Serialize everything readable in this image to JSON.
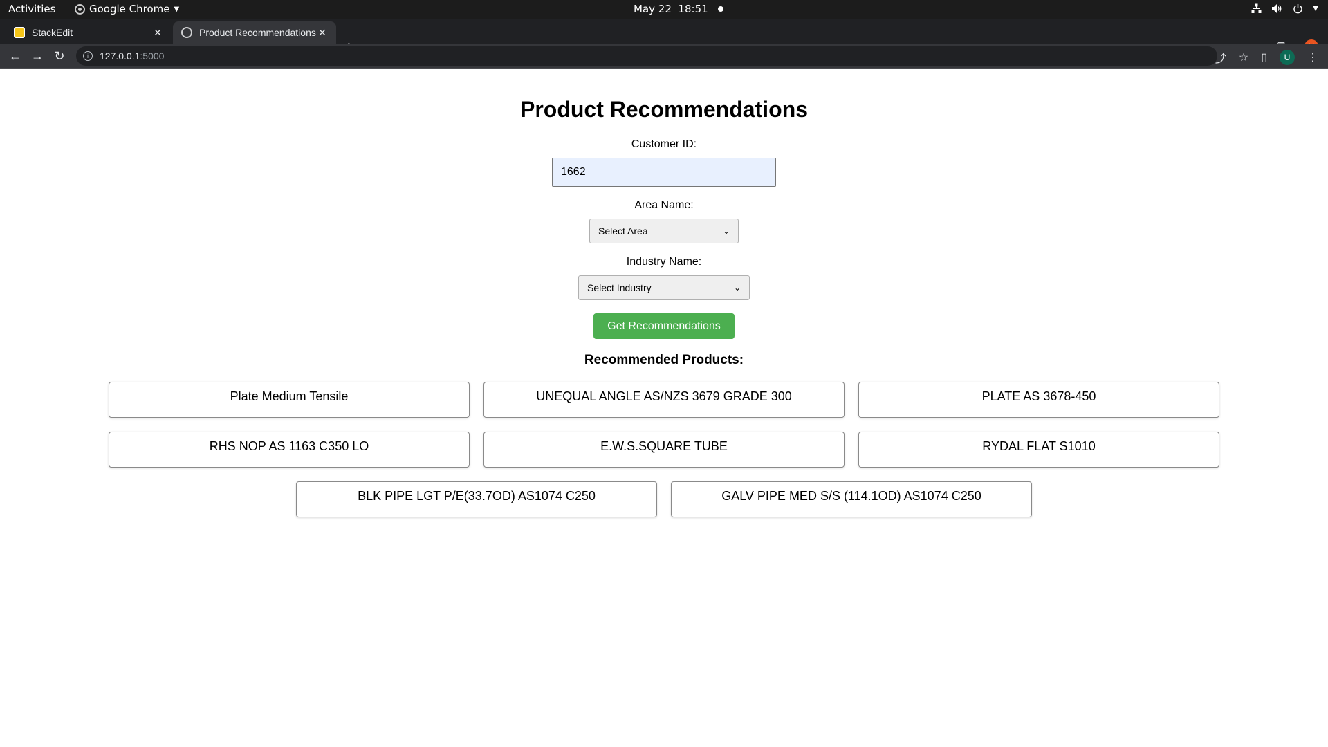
{
  "system_bar": {
    "activities": "Activities",
    "app_name": "Google Chrome",
    "date": "May 22",
    "time": "18:51"
  },
  "browser": {
    "tabs": [
      {
        "title": "StackEdit",
        "active": false
      },
      {
        "title": "Product Recommendations",
        "active": true
      }
    ],
    "url_host": "127.0.0.1",
    "url_port": ":5000",
    "profile_initial": "U"
  },
  "form": {
    "title": "Product Recommendations",
    "customer_id_label": "Customer ID:",
    "customer_id_value": "1662",
    "area_label": "Area Name:",
    "area_selected": "Select Area",
    "industry_label": "Industry Name:",
    "industry_selected": "Select Industry",
    "submit_label": "Get Recommendations",
    "submit_color": "#4caf50"
  },
  "results": {
    "heading": "Recommended Products:",
    "products": [
      "Plate Medium Tensile",
      "UNEQUAL ANGLE AS/NZS 3679 GRADE 300",
      "PLATE AS 3678-450",
      "RHS NOP AS 1163 C350 LO",
      "E.W.S.SQUARE TUBE",
      "RYDAL FLAT S1010",
      "BLK PIPE LGT P/E(33.7OD) AS1074 C250",
      "GALV PIPE MED S/S (114.1OD) AS1074 C250"
    ]
  }
}
